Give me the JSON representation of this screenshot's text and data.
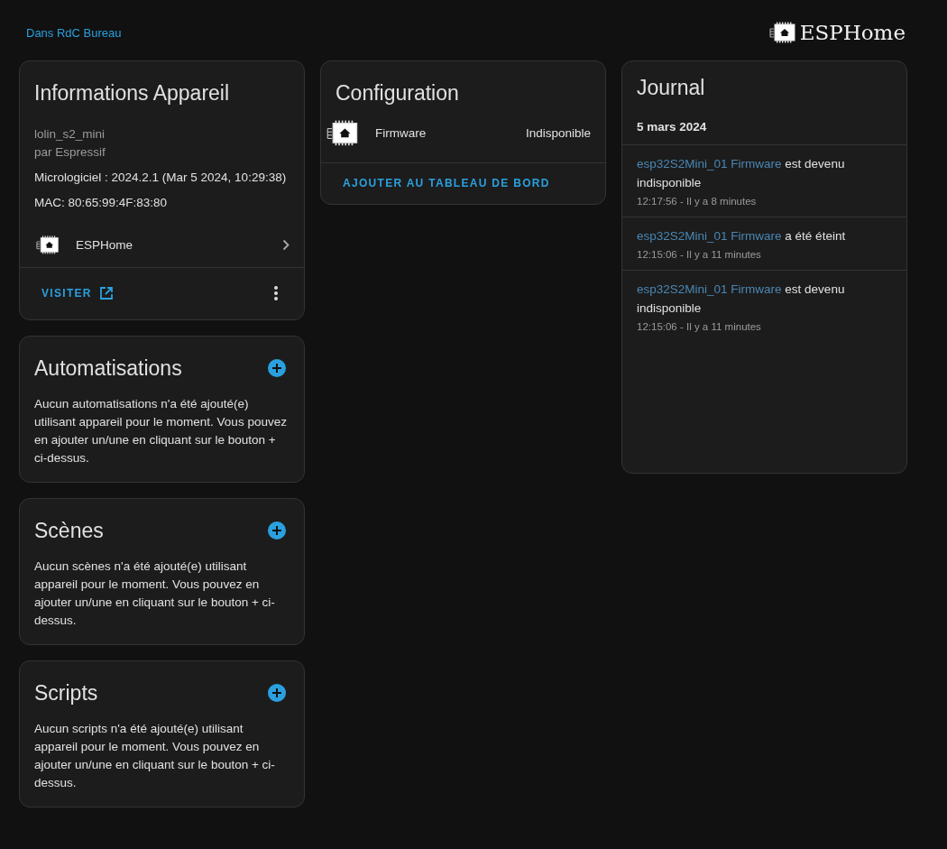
{
  "header": {
    "area_link": "Dans RdC Bureau",
    "brand": "ESPHome"
  },
  "device_info": {
    "title": "Informations Appareil",
    "model": "lolin_s2_mini",
    "manufacturer": "par Espressif",
    "firmware": "Micrologiciel : 2024.2.1 (Mar 5 2024, 10:29:38)",
    "mac": "MAC: 80:65:99:4F:83:80",
    "integration": "ESPHome",
    "visit_button": "VISITER"
  },
  "sections": [
    {
      "title": "Automatisations",
      "description": "Aucun automatisations n'a été ajouté(e) utilisant appareil pour le moment. Vous pouvez en ajouter un/une en cliquant sur le bouton + ci-dessus."
    },
    {
      "title": "Scènes",
      "description": "Aucun scènes n'a été ajouté(e) utilisant appareil pour le moment. Vous pouvez en ajouter un/une en cliquant sur le bouton + ci-dessus."
    },
    {
      "title": "Scripts",
      "description": "Aucun scripts n'a été ajouté(e) utilisant appareil pour le moment. Vous pouvez en ajouter un/une en cliquant sur le bouton + ci-dessus."
    }
  ],
  "configuration": {
    "title": "Configuration",
    "entities": [
      {
        "name": "Firmware",
        "state": "Indisponible"
      }
    ],
    "add_button": "AJOUTER AU TABLEAU DE BORD"
  },
  "journal": {
    "title": "Journal",
    "date": "5 mars 2024",
    "entries": [
      {
        "entity": "esp32S2Mini_01 Firmware",
        "message": "est devenu indisponible",
        "time": "12:17:56 - Il y a 8 minutes"
      },
      {
        "entity": "esp32S2Mini_01 Firmware",
        "message": "a été éteint",
        "time": "12:15:06 - Il y a 11 minutes"
      },
      {
        "entity": "esp32S2Mini_01 Firmware",
        "message": "est devenu indisponible",
        "time": "12:15:06 - Il y a 11 minutes"
      }
    ]
  }
}
